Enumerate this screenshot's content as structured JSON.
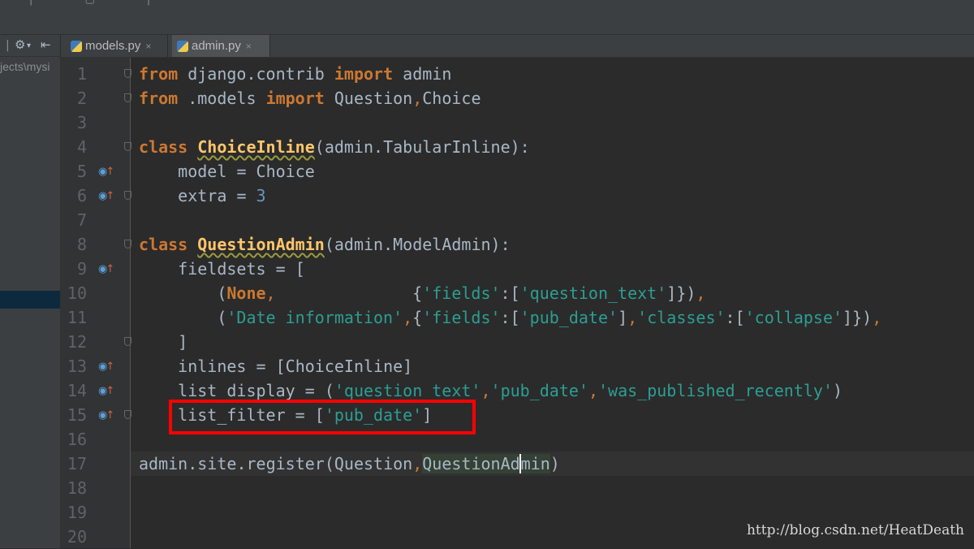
{
  "window": {
    "menu_fragment": "| ▢ |"
  },
  "project": {
    "path_fragment": "jects\\mysi"
  },
  "toolbar": {
    "separator": "|",
    "settings_icon": "gear-icon",
    "collapse_icon": "collapse-left-icon"
  },
  "tabs": [
    {
      "label": "models.py",
      "close": "×",
      "icon": "python-file-icon"
    },
    {
      "label": "admin.py",
      "close": "×",
      "icon": "python-file-icon",
      "active": true
    }
  ],
  "editor": {
    "line_numbers": [
      "1",
      "2",
      "3",
      "4",
      "5",
      "6",
      "7",
      "8",
      "9",
      "10",
      "11",
      "12",
      "13",
      "14",
      "15",
      "16",
      "17",
      "18",
      "19",
      "20"
    ],
    "override_markers": [
      5,
      6,
      9,
      13,
      14,
      15
    ],
    "current_line": 17,
    "highlighted_line": 15,
    "lines": [
      "from django.contrib import admin",
      "from .models import Question,Choice",
      "",
      "class ChoiceInline(admin.TabularInline):",
      "    model = Choice",
      "    extra = 3",
      "",
      "class QuestionAdmin(admin.ModelAdmin):",
      "    fieldsets = [",
      "        (None,              {'fields':['question_text']}),",
      "        ('Date information',{'fields':['pub_date'],'classes':['collapse']}),",
      "    ]",
      "    inlines = [ChoiceInline]",
      "    list_display = ('question_text','pub_date','was_published_recently')",
      "    list_filter = ['pub_date']",
      "",
      "admin.site.register(Question,QuestionAdmin)",
      "",
      "",
      ""
    ]
  },
  "watermark": "http://blog.csdn.net/HeatDeath"
}
